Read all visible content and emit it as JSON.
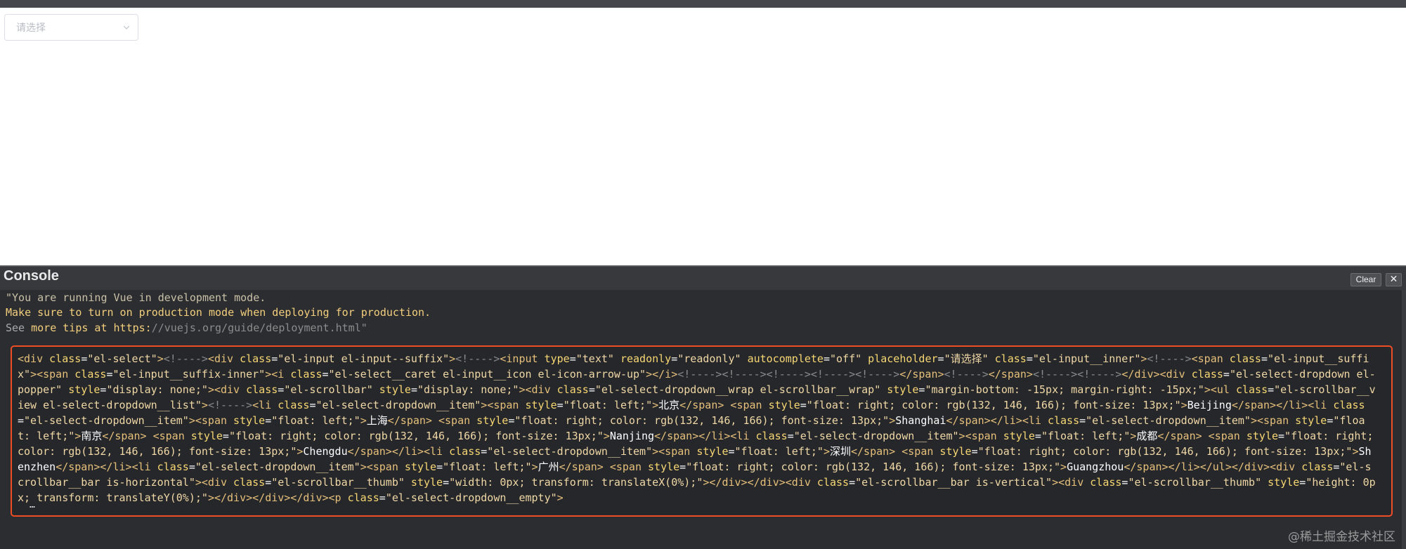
{
  "preview": {
    "select": {
      "placeholder": "请选择",
      "caret_icon": "chevron-down-icon"
    }
  },
  "console": {
    "title": "Console",
    "clear_label": "Clear",
    "close_label": "✕",
    "logs": {
      "line1": "\"You are running Vue in development mode.",
      "line2": "Make sure to turn on production mode when deploying for production.",
      "line3_prefix": "See ",
      "line3_highlight": "more tips at https:",
      "line3_link": "//vuejs.org/guide/deployment.html\""
    },
    "output": {
      "tokens": [
        "<div",
        " class",
        "=",
        "\"el-select\"",
        ">",
        "<!---->",
        "<div",
        " class",
        "=",
        "\"el-input el-input--suffix\"",
        ">",
        "<!---->",
        "<input",
        " type",
        "=",
        "\"text\"",
        " readonly",
        "=",
        "\"readonly\"",
        " autocomplete",
        "=",
        "\"off\"",
        " placeholder",
        "=",
        "\"请选择\"",
        " class",
        "=",
        "\"el-input__inner\"",
        ">",
        "<!---->",
        "<span",
        " class",
        "=",
        "\"el-input__suffix\"",
        ">",
        "<span",
        " class",
        "=",
        "\"el-input__suffix-inner\"",
        ">",
        "<i",
        " class",
        "=",
        "\"el-select__caret el-input__icon el-icon-arrow-up\"",
        ">",
        "</i>",
        "<!----><!----><!----><!----><!---->",
        "</span>",
        "<!---->",
        "</span>",
        "<!----><!---->",
        "</div>",
        "<div",
        " class",
        "=",
        "\"el-select-dropdown el-popper\"",
        " style",
        "=",
        "\"display: none;\"",
        ">",
        "<div",
        " class",
        "=",
        "\"el-scrollbar\"",
        " style",
        "=",
        "\"display: none;\"",
        ">",
        "<div",
        " class",
        "=",
        "\"el-select-dropdown__wrap el-scrollbar__wrap\"",
        " style",
        "=",
        "\"margin-bottom: -15px; margin-right: -15px;\"",
        ">",
        "<ul",
        " class",
        "=",
        "\"el-scrollbar__view el-select-dropdown__list\"",
        ">",
        "<!---->",
        "<li",
        " class",
        "=",
        "\"el-select-dropdown__item\"",
        ">",
        "<span",
        " style",
        "=",
        "\"float: left;\"",
        ">",
        "北京",
        "</span>",
        " ",
        "<span",
        " style",
        "=",
        "\"float: right; color: rgb(132, 146, 166); font-size: 13px;\"",
        ">",
        "Beijing",
        "</span>",
        "</li>",
        "<li",
        " class",
        "=",
        "\"el-select-dropdown__item\"",
        ">",
        "<span",
        " style",
        "=",
        "\"float: left;\"",
        ">",
        "上海",
        "</span>",
        " ",
        "<span",
        " style",
        "=",
        "\"float: right; color: rgb(132, 146, 166); font-size: 13px;\"",
        ">",
        "Shanghai",
        "</span>",
        "</li>",
        "<li",
        " class",
        "=",
        "\"el-select-dropdown__item\"",
        ">",
        "<span",
        " style",
        "=",
        "\"float: left;\"",
        ">",
        "南京",
        "</span>",
        " ",
        "<span",
        " style",
        "=",
        "\"float: right; color: rgb(132, 146, 166); font-size: 13px;\"",
        ">",
        "Nanjing",
        "</span>",
        "</li>",
        "<li",
        " class",
        "=",
        "\"el-select-dropdown__item\"",
        ">",
        "<span",
        " style",
        "=",
        "\"float: left;\"",
        ">",
        "成都",
        "</span>",
        " ",
        "<span",
        " style",
        "=",
        "\"float: right; color: rgb(132, 146, 166); font-size: 13px;\"",
        ">",
        "Chengdu",
        "</span>",
        "</li>",
        "<li",
        " class",
        "=",
        "\"el-select-dropdown__item\"",
        ">",
        "<span",
        " style",
        "=",
        "\"float: left;\"",
        ">",
        "深圳",
        "</span>",
        " ",
        "<span",
        " style",
        "=",
        "\"float: right; color: rgb(132, 146, 166); font-size: 13px;\"",
        ">",
        "Shenzhen",
        "</span>",
        "</li>",
        "<li",
        " class",
        "=",
        "\"el-select-dropdown__item\"",
        ">",
        "<span",
        " style",
        "=",
        "\"float: left;\"",
        ">",
        "广州",
        "</span>",
        " ",
        "<span",
        " style",
        "=",
        "\"float: right; color: rgb(132, 146, 166); font-size: 13px;\"",
        ">",
        "Guangzhou",
        "</span>",
        "</li>",
        "</ul>",
        "</div>",
        "<div",
        " class",
        "=",
        "\"el-scrollbar__bar is-horizontal\"",
        ">",
        "<div",
        " class",
        "=",
        "\"el-scrollbar__thumb\"",
        " style",
        "=",
        "\"width: 0px; transform: translateX(0%);\"",
        ">",
        "</div>",
        "</div>",
        "<div",
        " class",
        "=",
        "\"el-scrollbar__bar is-vertical\"",
        ">",
        "<div",
        " class",
        "=",
        "\"el-scrollbar__thumb\"",
        " style",
        "=",
        "\"height: 0px; transform: translateY(0%);\"",
        ">",
        "</div>",
        "</div>",
        "</div>",
        "<p",
        " class",
        "=",
        "\"el-select-dropdown__empty\"",
        ">"
      ],
      "ellipsis": "…"
    }
  },
  "watermark": "@稀土掘金技术社区",
  "colors": {
    "console_bg": "#2c2d30",
    "highlight_border": "#ef4e24",
    "tag": "#e6c07b",
    "attr": "#f7d774",
    "comment": "#8a8a8a",
    "warning": "#f3cf7d"
  }
}
